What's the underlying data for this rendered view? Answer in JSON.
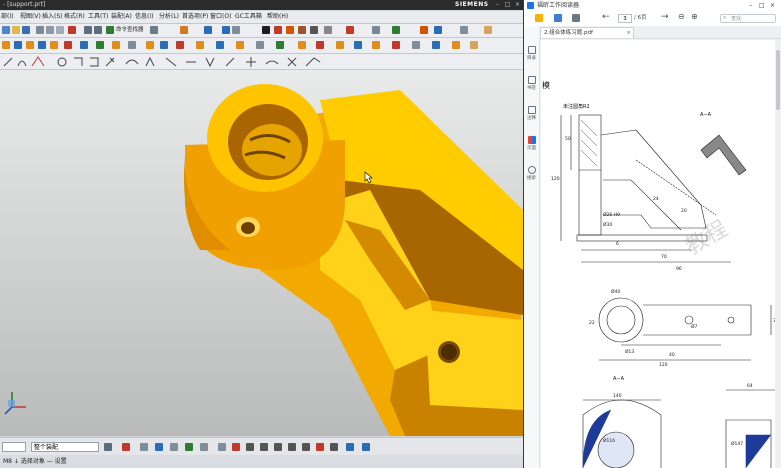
{
  "nx": {
    "title": "- [support.prt]",
    "brand": "SIEMENS",
    "menu": [
      "部(I)",
      "视图(V)",
      "插入(S)",
      "格式(R)",
      "工具(T)",
      "装配(A)",
      "信息(I)",
      "分析(L)",
      "首选项(P)",
      "窗口(O)",
      "GC工具箱",
      "帮助(H)"
    ],
    "toolbar_text": "命令查找器",
    "filter_select": "整个装配",
    "status_text": "M8 ↓ 选择对象 — 设置",
    "viewport_label": "3D model view"
  },
  "pdf": {
    "title": "福昕工作阅读器",
    "tab_label": "2.组合体练习题.pdf",
    "page_input": "3",
    "page_total": "/ 6页",
    "search_placeholder": "查找",
    "side_labels": [
      "目录",
      "书签",
      "注释",
      "页面",
      "搜索"
    ],
    "page_heading": "模",
    "drawing_note": "未注圆角R2",
    "section_label_1": "A−A",
    "section_label_2": "A−A",
    "dims": [
      "50",
      "120",
      "Ø26 H9",
      "Ø30",
      "24",
      "6",
      "20",
      "70",
      "96",
      "Ø40",
      "22",
      "Ø7",
      "120",
      "Ø13",
      "40",
      "36",
      "140",
      "64",
      "Ø116",
      "Ø147"
    ]
  },
  "colors": {
    "model_main": "#f2a900",
    "model_dark": "#b06f00",
    "model_light": "#ffd21a",
    "accent_blue": "#1a73e8"
  }
}
